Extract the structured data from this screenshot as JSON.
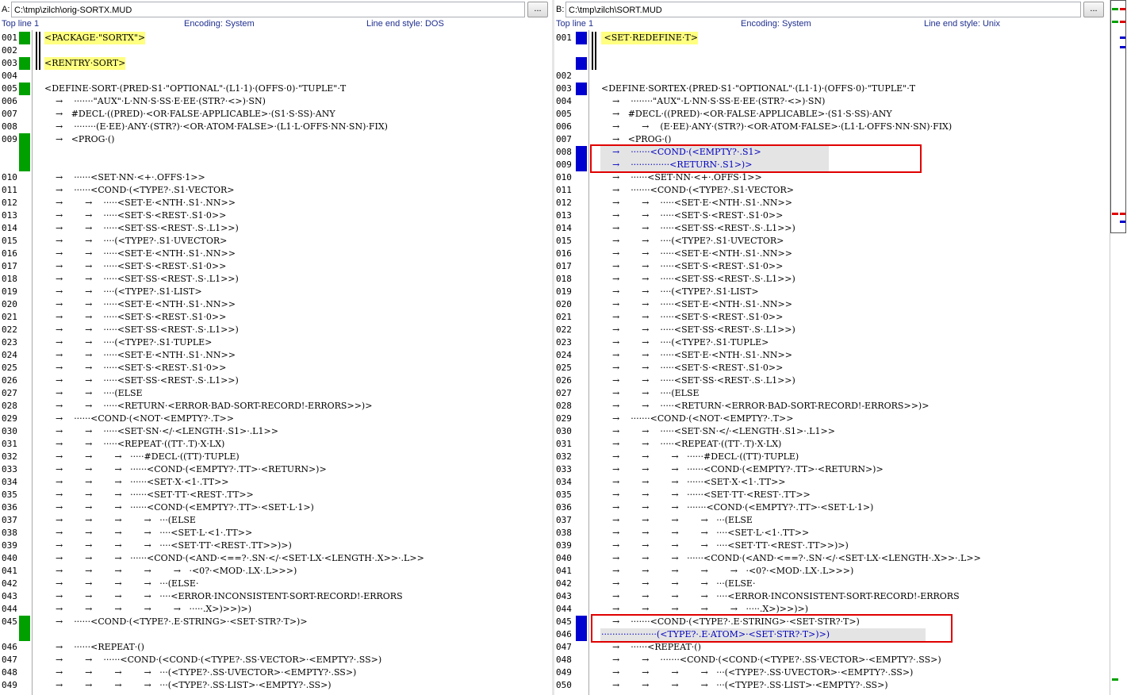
{
  "colors": {
    "inserted": "#00a000",
    "changed": "#0000d0",
    "highlight": "#ffff80",
    "box": "#e00000"
  },
  "left": {
    "side": "A:",
    "path": "C:\\tmp\\zilch\\orig-SORTX.MUD",
    "browse": "...",
    "top_line": "Top line 1",
    "encoding": "Encoding: System",
    "line_end": "Line end style: DOS",
    "rows": [
      {
        "ln": "001",
        "text": "<PACKAGE·\"SORTX\">",
        "slot": 0
      },
      {
        "ln": "002",
        "text": "",
        "slot": 1
      },
      {
        "ln": "003",
        "text": "<RENTRY·SORT>",
        "slot": 2
      },
      {
        "ln": "004",
        "text": "",
        "slot": 3
      },
      {
        "ln": "005",
        "text": "<DEFINE·SORT·(PRED·S1·\"OPTIONAL\"·(L1·1)·(OFFS·0)·\"TUPLE\"·T",
        "slot": 4
      },
      {
        "ln": "006",
        "text": "    →    ·······\"AUX\"·L·NN·S·SS·E·EE·(STR?·<>)·SN)",
        "slot": 5
      },
      {
        "ln": "007",
        "text": "    →   #DECL·((PRED)·<OR·FALSE·APPLICABLE>·(S1·S·SS)·ANY",
        "slot": 6
      },
      {
        "ln": "008",
        "text": "    →    ········(E·EE)·ANY·(STR?)·<OR·ATOM·FALSE>·(L1·L·OFFS·NN·SN)·FIX)",
        "slot": 7
      },
      {
        "ln": "009",
        "text": "    →   <PROG·()",
        "slot": 8
      },
      {
        "ln": "010",
        "text": "    →    ······<SET·NN·<+·.OFFS·1>>",
        "slot": 11
      },
      {
        "ln": "011",
        "text": "    →    ······<COND·(<TYPE?·.S1·VECTOR>",
        "slot": 12
      },
      {
        "ln": "012",
        "text": "    →        →    ·····<SET·E·<NTH·.S1·.NN>>",
        "slot": 13
      },
      {
        "ln": "013",
        "text": "    →        →    ·····<SET·S·<REST·.S1·0>>",
        "slot": 14
      },
      {
        "ln": "014",
        "text": "    →        →    ·····<SET·SS·<REST·.S·.L1>>)",
        "slot": 15
      },
      {
        "ln": "015",
        "text": "    →        →    ····(<TYPE?·.S1·UVECTOR>",
        "slot": 16
      },
      {
        "ln": "016",
        "text": "    →        →    ·····<SET·E·<NTH·.S1·.NN>>",
        "slot": 17
      },
      {
        "ln": "017",
        "text": "    →        →    ·····<SET·S·<REST·.S1·0>>",
        "slot": 18
      },
      {
        "ln": "018",
        "text": "    →        →    ·····<SET·SS·<REST·.S·.L1>>)",
        "slot": 19
      },
      {
        "ln": "019",
        "text": "    →        →    ····(<TYPE?·.S1·LIST>",
        "slot": 20
      },
      {
        "ln": "020",
        "text": "    →        →    ·····<SET·E·<NTH·.S1·.NN>>",
        "slot": 21
      },
      {
        "ln": "021",
        "text": "    →        →    ·····<SET·S·<REST·.S1·0>>",
        "slot": 22
      },
      {
        "ln": "022",
        "text": "    →        →    ·····<SET·SS·<REST·.S·.L1>>)",
        "slot": 23
      },
      {
        "ln": "023",
        "text": "    →        →    ····(<TYPE?·.S1·TUPLE>",
        "slot": 24
      },
      {
        "ln": "024",
        "text": "    →        →    ·····<SET·E·<NTH·.S1·.NN>>",
        "slot": 25
      },
      {
        "ln": "025",
        "text": "    →        →    ·····<SET·S·<REST·.S1·0>>",
        "slot": 26
      },
      {
        "ln": "026",
        "text": "    →        →    ·····<SET·SS·<REST·.S·.L1>>)",
        "slot": 27
      },
      {
        "ln": "027",
        "text": "    →        →    ····(ELSE",
        "slot": 28
      },
      {
        "ln": "028",
        "text": "    →        →    ·····<RETURN·<ERROR·BAD-SORT-RECORD!-ERRORS>>)>",
        "slot": 29
      },
      {
        "ln": "029",
        "text": "    →    ······<COND·(<NOT·<EMPTY?·.T>>",
        "slot": 30
      },
      {
        "ln": "030",
        "text": "    →        →    ·····<SET·SN·</·<LENGTH·.S1>·.L1>>",
        "slot": 31
      },
      {
        "ln": "031",
        "text": "    →        →    ·····<REPEAT·((TT·.T)·X·LX)",
        "slot": 32
      },
      {
        "ln": "032",
        "text": "    →        →        →   ·····#DECL·((TT)·TUPLE)",
        "slot": 33
      },
      {
        "ln": "033",
        "text": "    →        →        →   ······<COND·(<EMPTY?·.TT>·<RETURN>)>",
        "slot": 34
      },
      {
        "ln": "034",
        "text": "    →        →        →   ······<SET·X·<1·.TT>>",
        "slot": 35
      },
      {
        "ln": "035",
        "text": "    →        →        →   ······<SET·TT·<REST·.TT>>",
        "slot": 36
      },
      {
        "ln": "036",
        "text": "    →        →        →   ······<COND·(<EMPTY?·.TT>·<SET·L·1>)",
        "slot": 37
      },
      {
        "ln": "037",
        "text": "    →        →        →        →   ···(ELSE",
        "slot": 38
      },
      {
        "ln": "038",
        "text": "    →        →        →        →   ····<SET·L·<1·.TT>>",
        "slot": 39
      },
      {
        "ln": "039",
        "text": "    →        →        →        →   ····<SET·TT·<REST·.TT>>)>)",
        "slot": 40
      },
      {
        "ln": "040",
        "text": "    →        →        →   ······<COND·(<AND·<==?·.SN·</·<SET·LX·<LENGTH·.X>>·.L>>",
        "slot": 41
      },
      {
        "ln": "041",
        "text": "    →        →        →        →        →   ·<0?·<MOD·.LX·.L>>>)",
        "slot": 42
      },
      {
        "ln": "042",
        "text": "    →        →        →        →   ···(ELSE·",
        "slot": 43
      },
      {
        "ln": "043",
        "text": "    →        →        →        →   ····<ERROR·INCONSISTENT-SORT-RECORD!-ERRORS",
        "slot": 44
      },
      {
        "ln": "044",
        "text": "    →        →        →        →        →   ·····.X>)>>)>)",
        "slot": 45
      },
      {
        "ln": "045",
        "text": "    →    ······<COND·(<TYPE?·.E·STRING>·<SET·STR?·T>)>",
        "slot": 46
      },
      {
        "ln": "046",
        "text": "    →    ······<REPEAT·()",
        "slot": 48
      },
      {
        "ln": "047",
        "text": "    →        →    ······<COND·(<COND·(<TYPE?·.SS·VECTOR>·<EMPTY?·.SS>)",
        "slot": 49
      },
      {
        "ln": "048",
        "text": "    →        →        →        →   ···(<TYPE?·.SS·UVECTOR>·<EMPTY?·.SS>)",
        "slot": 50
      },
      {
        "ln": "049",
        "text": "    →        →        →        →   ···(<TYPE?·.SS·LIST>·<EMPTY?·.SS>)",
        "slot": 51
      }
    ]
  },
  "right": {
    "side": "B:",
    "path": "C:\\tmp\\zilch\\SORT.MUD",
    "browse": "...",
    "top_line": "Top line 1",
    "encoding": "Encoding: System",
    "line_end": "Line end style: Unix",
    "rows": [
      {
        "ln": "001",
        "text": " <SET·REDEFINE·T>",
        "slot": 0
      },
      {
        "ln": "002",
        "text": "",
        "slot": 3
      },
      {
        "ln": "003",
        "text": "<DEFINE·SORTEX·(PRED·S1·\"OPTIONAL\"·(L1·1)·(OFFS·0)·\"TUPLE\"·T",
        "slot": 4
      },
      {
        "ln": "004",
        "text": "    →    ········\"AUX\"·L·NN·S·SS·E·EE·(STR?·<>)·SN)",
        "slot": 5
      },
      {
        "ln": "005",
        "text": "    →   #DECL·((PRED)·<OR·FALSE·APPLICABLE>·(S1·S·SS)·ANY",
        "slot": 6
      },
      {
        "ln": "006",
        "text": "    →        →    (E·EE)·ANY·(STR?)·<OR·ATOM·FALSE>·(L1·L·OFFS·NN·SN)·FIX)",
        "slot": 7
      },
      {
        "ln": "007",
        "text": "    →   <PROG·()",
        "slot": 8
      },
      {
        "ln": "008",
        "text": "    →    ·······<COND·(<EMPTY?·.S1>",
        "slot": 9
      },
      {
        "ln": "009",
        "text": "    →    ··············<RETURN·.S1>)>",
        "slot": 10
      },
      {
        "ln": "010",
        "text": "    →    ······<SET·NN·<+·.OFFS·1>>",
        "slot": 11
      },
      {
        "ln": "011",
        "text": "    →    ·······<COND·(<TYPE?·.S1·VECTOR>",
        "slot": 12
      },
      {
        "ln": "012",
        "text": "    →        →    ·····<SET·E·<NTH·.S1·.NN>>",
        "slot": 13
      },
      {
        "ln": "013",
        "text": "    →        →    ·····<SET·S·<REST·.S1·0>>",
        "slot": 14
      },
      {
        "ln": "014",
        "text": "    →        →    ·····<SET·SS·<REST·.S·.L1>>)",
        "slot": 15
      },
      {
        "ln": "015",
        "text": "    →        →    ····(<TYPE?·.S1·UVECTOR>",
        "slot": 16
      },
      {
        "ln": "016",
        "text": "    →        →    ·····<SET·E·<NTH·.S1·.NN>>",
        "slot": 17
      },
      {
        "ln": "017",
        "text": "    →        →    ·····<SET·S·<REST·.S1·0>>",
        "slot": 18
      },
      {
        "ln": "018",
        "text": "    →        →    ·····<SET·SS·<REST·.S·.L1>>)",
        "slot": 19
      },
      {
        "ln": "019",
        "text": "    →        →    ····(<TYPE?·.S1·LIST>",
        "slot": 20
      },
      {
        "ln": "020",
        "text": "    →        →    ·····<SET·E·<NTH·.S1·.NN>>",
        "slot": 21
      },
      {
        "ln": "021",
        "text": "    →        →    ·····<SET·S·<REST·.S1·0>>",
        "slot": 22
      },
      {
        "ln": "022",
        "text": "    →        →    ·····<SET·SS·<REST·.S·.L1>>)",
        "slot": 23
      },
      {
        "ln": "023",
        "text": "    →        →    ····(<TYPE?·.S1·TUPLE>",
        "slot": 24
      },
      {
        "ln": "024",
        "text": "    →        →    ·····<SET·E·<NTH·.S1·.NN>>",
        "slot": 25
      },
      {
        "ln": "025",
        "text": "    →        →    ·····<SET·S·<REST·.S1·0>>",
        "slot": 26
      },
      {
        "ln": "026",
        "text": "    →        →    ·····<SET·SS·<REST·.S·.L1>>)",
        "slot": 27
      },
      {
        "ln": "027",
        "text": "    →        →    ····(ELSE",
        "slot": 28
      },
      {
        "ln": "028",
        "text": "    →        →    ·····<RETURN·<ERROR·BAD-SORT-RECORD!-ERRORS>>)>",
        "slot": 29
      },
      {
        "ln": "029",
        "text": "    →    ·······<COND·(<NOT·<EMPTY?·.T>>",
        "slot": 30
      },
      {
        "ln": "030",
        "text": "    →        →    ·····<SET·SN·</·<LENGTH·.S1>·.L1>>",
        "slot": 31
      },
      {
        "ln": "031",
        "text": "    →        →    ·····<REPEAT·((TT·.T)·X·LX)",
        "slot": 32
      },
      {
        "ln": "032",
        "text": "    →        →        →   ······#DECL·((TT)·TUPLE)",
        "slot": 33
      },
      {
        "ln": "033",
        "text": "    →        →        →   ······<COND·(<EMPTY?·.TT>·<RETURN>)>",
        "slot": 34
      },
      {
        "ln": "034",
        "text": "    →        →        →   ······<SET·X·<1·.TT>>",
        "slot": 35
      },
      {
        "ln": "035",
        "text": "    →        →        →   ······<SET·TT·<REST·.TT>>",
        "slot": 36
      },
      {
        "ln": "036",
        "text": "    →        →        →   ·······<COND·(<EMPTY?·.TT>·<SET·L·1>)",
        "slot": 37
      },
      {
        "ln": "037",
        "text": "    →        →        →        →   ···(ELSE",
        "slot": 38
      },
      {
        "ln": "038",
        "text": "    →        →        →        →   ····<SET·L·<1·.TT>>",
        "slot": 39
      },
      {
        "ln": "039",
        "text": "    →        →        →        →   ····<SET·TT·<REST·.TT>>)>)",
        "slot": 40
      },
      {
        "ln": "040",
        "text": "    →        →        →   ······<COND·(<AND·<==?·.SN·</·<SET·LX·<LENGTH·.X>>·.L>>",
        "slot": 41
      },
      {
        "ln": "041",
        "text": "    →        →        →        →        →   ·<0?·<MOD·.LX·.L>>>)",
        "slot": 42
      },
      {
        "ln": "042",
        "text": "    →        →        →        →   ···(ELSE·",
        "slot": 43
      },
      {
        "ln": "043",
        "text": "    →        →        →        →   ····<ERROR·INCONSISTENT-SORT-RECORD!-ERRORS",
        "slot": 44
      },
      {
        "ln": "044",
        "text": "    →        →        →        →        →   ·····.X>)>>)>)",
        "slot": 45
      },
      {
        "ln": "045",
        "text": "    →    ·······<COND·(<TYPE?·.E·STRING>·<SET·STR?·T>)",
        "slot": 46
      },
      {
        "ln": "046",
        "text": "····················(<TYPE?·.E·ATOM>·<SET·STR?·T>)>)",
        "slot": 47
      },
      {
        "ln": "047",
        "text": "    →    ······<REPEAT·()",
        "slot": 48
      },
      {
        "ln": "048",
        "text": "    →        →    ·······<COND·(<COND·(<TYPE?·.SS·VECTOR>·<EMPTY?·.SS>)",
        "slot": 49
      },
      {
        "ln": "049",
        "text": "    →        →        →        →   ···(<TYPE?·.SS·UVECTOR>·<EMPTY?·.SS>)",
        "slot": 50
      },
      {
        "ln": "050",
        "text": "    →        →        →        →   ···(<TYPE?·.SS·LIST>·<EMPTY?·.SS>)",
        "slot": 51
      }
    ]
  }
}
